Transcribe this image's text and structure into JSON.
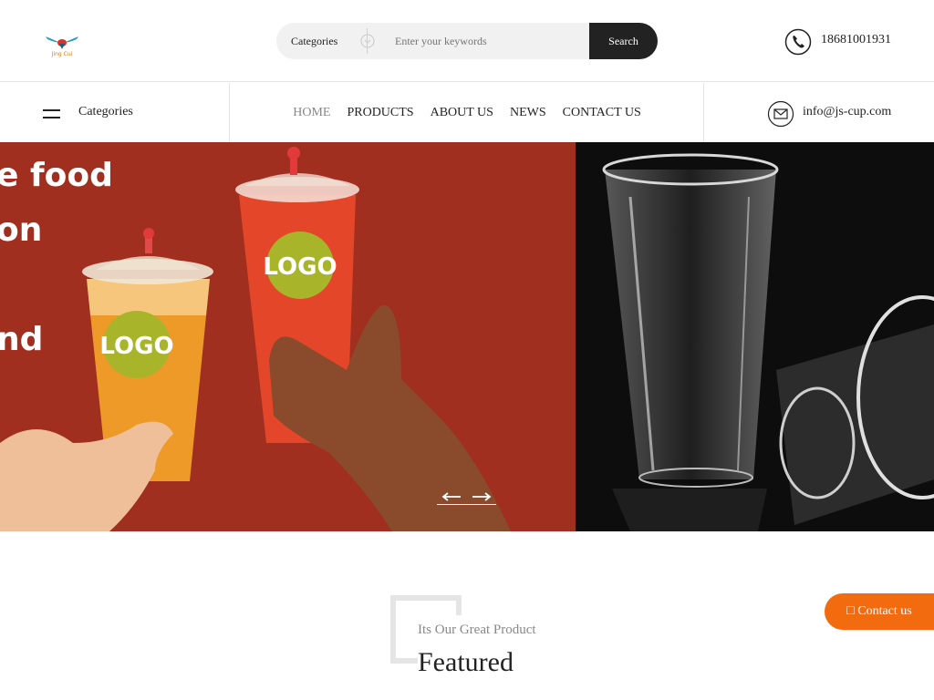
{
  "header": {
    "logo_text": "Jing Cui",
    "search": {
      "category_label": "Categories",
      "placeholder": "Enter your keywords",
      "button_label": "Search"
    },
    "phone": "18681001931"
  },
  "nav": {
    "categories_label": "Categories",
    "menu": [
      "HOME",
      "PRODUCTS",
      "ABOUT US",
      "NEWS",
      "CONTACT US"
    ],
    "active": "HOME",
    "email": "info@js-cup.com"
  },
  "banner": {
    "slogan_lines": [
      "e food",
      "on",
      "nd"
    ],
    "cup_logo_text": "LOGO",
    "colors": {
      "left_bg": "#a12f20",
      "right_bg": "#0d0d0d",
      "logo_badge": "#a8b52a"
    }
  },
  "featured": {
    "subtitle": "Its Our Great Product",
    "title": "Featured"
  },
  "contact_button": {
    "icon": "chat-icon",
    "label": "Contact us",
    "color": "#f26b0f"
  }
}
